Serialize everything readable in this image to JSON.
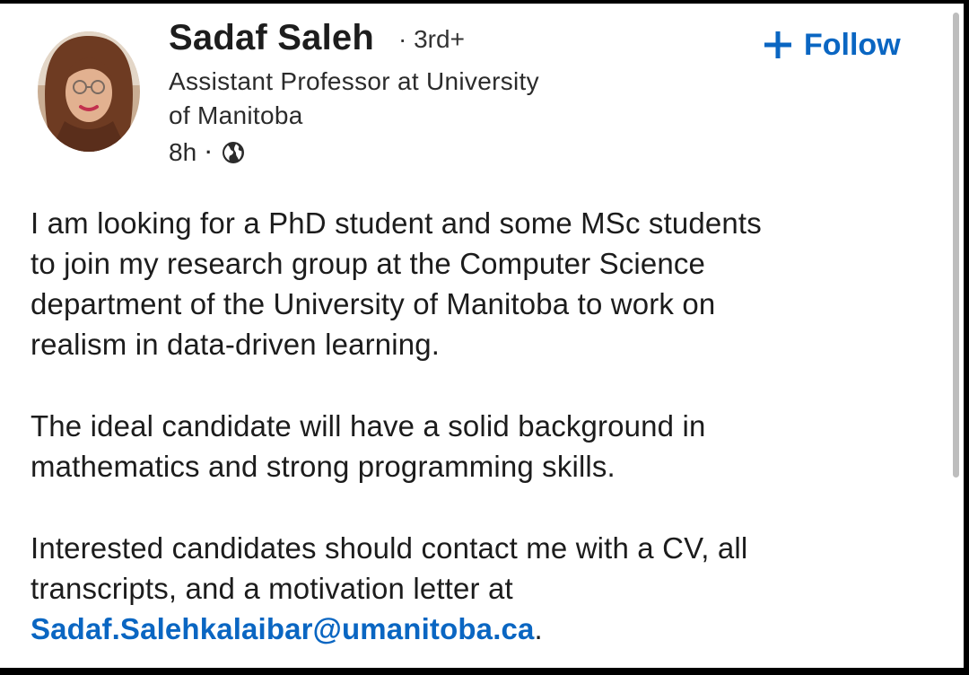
{
  "post": {
    "author": {
      "name": "Sadaf Saleh",
      "degree_separator": "·",
      "degree": "3rd+",
      "headline_line1": "Assistant Professor at University",
      "headline_line2": "of Manitoba",
      "time_ago": "8h",
      "meta_separator": "·",
      "visibility_icon": "globe-icon"
    },
    "follow": {
      "icon": "plus-icon",
      "label": "Follow"
    },
    "body": {
      "line1": "I am looking for a PhD student and some MSc students",
      "line2": "to join my research group at the Computer Science",
      "line3": "department of the University of Manitoba to work on",
      "line4": "realism in data-driven learning.",
      "line5": "The ideal candidate will have a solid background in",
      "line6": "mathematics and strong programming skills.",
      "line7": "Interested candidates should contact me with a CV, all",
      "line8": "transcripts, and a motivation letter at",
      "email": "Sadaf.Salehkalaibar@umanitoba.ca",
      "end_punct": "."
    }
  },
  "colors": {
    "accent": "#0a66c2",
    "text": "#1c1c1c",
    "background": "#ffffff",
    "frame": "#000000"
  }
}
